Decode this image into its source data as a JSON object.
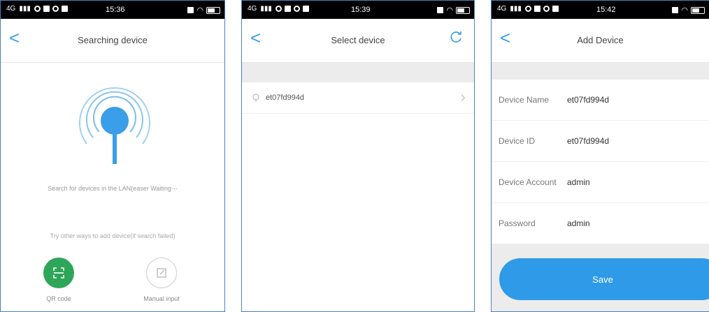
{
  "screens": [
    {
      "status": {
        "carrier": "4G",
        "time": "15:36"
      },
      "nav": {
        "back": "<",
        "title": "Searching device"
      },
      "search_status": "Search for devices in the LAN(easer Waiting···",
      "try_other": "Try other ways to add device(if search failed)",
      "options": [
        {
          "label": "QR code",
          "icon": "qr-code-icon"
        },
        {
          "label": "Manual input",
          "icon": "edit-icon"
        }
      ]
    },
    {
      "status": {
        "carrier": "4G",
        "time": "15:39"
      },
      "nav": {
        "back": "<",
        "title": "Select device",
        "refresh_icon": "refresh-icon"
      },
      "devices": [
        {
          "name": "et07fd994d"
        }
      ]
    },
    {
      "status": {
        "carrier": "4G",
        "time": "15:42"
      },
      "nav": {
        "back": "<",
        "title": "Add Device"
      },
      "fields": [
        {
          "label": "Device Name",
          "value": "et07fd994d"
        },
        {
          "label": "Device ID",
          "value": "et07fd994d"
        },
        {
          "label": "Device Account",
          "value": "admin"
        },
        {
          "label": "Password",
          "value": "admin"
        }
      ],
      "save_label": "Save"
    }
  ],
  "colors": {
    "accent": "#2f9be8",
    "qr_green": "#2ea65a",
    "statusbar": "#000000"
  }
}
